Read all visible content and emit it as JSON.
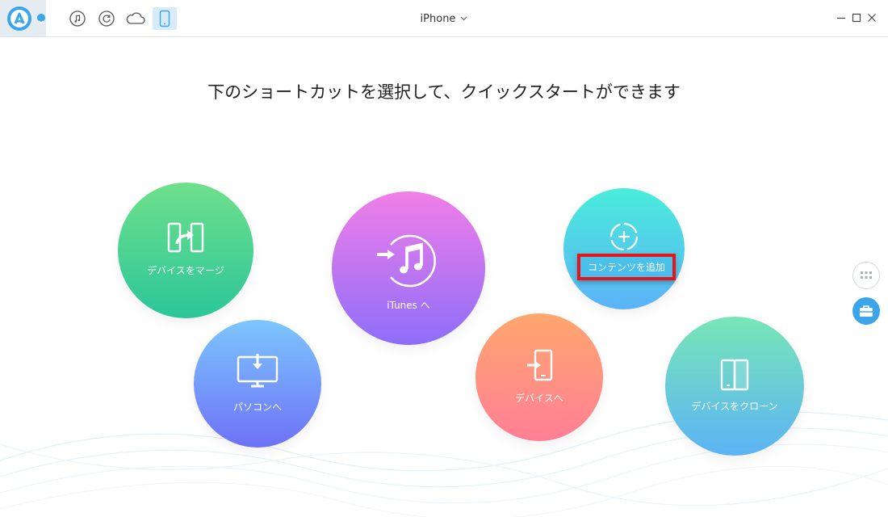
{
  "toolbar": {
    "device_title": "iPhone",
    "icons": [
      "app-logo-icon",
      "music-icon",
      "restore-icon",
      "cloud-icon",
      "phone-icon"
    ]
  },
  "headline": "下のショートカットを選択して、クイックスタートができます",
  "shortcuts": {
    "merge": {
      "label": "デバイスをマージ",
      "icon": "merge-device-icon",
      "colors": [
        "#6fe08c",
        "#2bc699"
      ]
    },
    "to_pc": {
      "label": "パソコンへ",
      "icon": "to-pc-icon",
      "colors": [
        "#7cc6fe",
        "#6e72f6"
      ]
    },
    "to_itunes": {
      "label": "iTunes へ",
      "icon": "itunes-icon",
      "colors": [
        "#f17ee8",
        "#8d6ef9"
      ]
    },
    "add_content": {
      "label": "コンテンツを追加",
      "icon": "add-content-icon",
      "colors": [
        "#49ecdb",
        "#5cb2f7"
      ]
    },
    "to_device": {
      "label": "デバイスへ",
      "icon": "to-device-icon",
      "colors": [
        "#ffa66e",
        "#ff7f95"
      ]
    },
    "clone": {
      "label": "デバイスをクローン",
      "icon": "clone-device-icon",
      "colors": [
        "#78e6b7",
        "#5cb3f5"
      ]
    }
  },
  "colors": {
    "accent": "#3aa5ea",
    "highlight_border": "#e8141b"
  }
}
